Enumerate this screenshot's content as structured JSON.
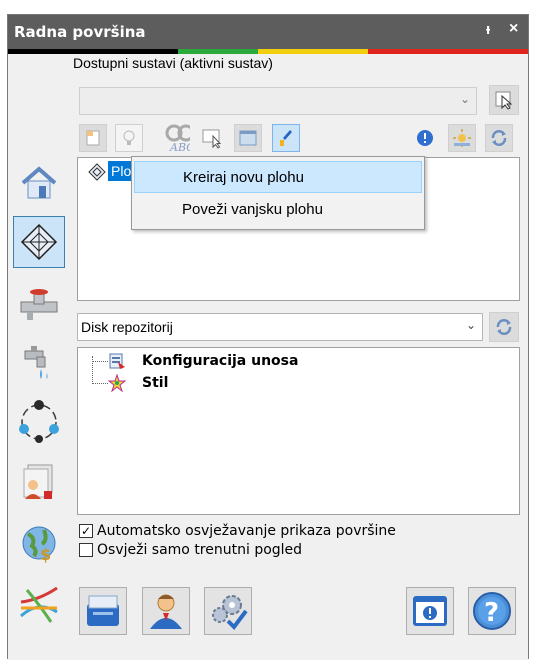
{
  "window": {
    "title": "Radna površina",
    "pin_glyph": "ᵻ",
    "close_glyph": "×"
  },
  "colors": {
    "title_bg": "#5d5d5d",
    "bar_green": "#2aaa3a",
    "bar_yellow": "#f2cf0d",
    "bar_red": "#e1231e",
    "selection": "#0078d7",
    "menu_hover": "#cce8ff"
  },
  "systems": {
    "label": "Dostupni sustavi (aktivni sustav)",
    "combo_value": "",
    "toolbar": [
      {
        "name": "new-document-icon"
      },
      {
        "name": "lightbulb-icon"
      },
      {
        "name": "abc-spellcheck-icon"
      },
      {
        "name": "select-cursor-icon"
      },
      {
        "name": "window-icon"
      },
      {
        "name": "brush-icon"
      },
      {
        "name": "info-icon"
      },
      {
        "name": "sun-icon"
      },
      {
        "name": "refresh-icon"
      }
    ]
  },
  "surfaces": {
    "item_label": "Ploh",
    "context_menu": [
      {
        "label": "Kreiraj novu plohu"
      },
      {
        "label": "Poveži vanjsku plohu"
      }
    ]
  },
  "repository": {
    "combo_value": "Disk repozitorij",
    "items": [
      {
        "label": "Konfiguracija unosa",
        "icon": "config-icon"
      },
      {
        "label": "Stil",
        "icon": "style-icon"
      }
    ]
  },
  "sidebar": [
    "home-icon",
    "surface-diamond-icon",
    "pipe-valve-icon",
    "water-tap-icon",
    "network-circle-icon",
    "user-report-icon",
    "globe-icon",
    "route-map-icon"
  ],
  "options": {
    "auto_refresh": {
      "label": "Automatsko osvježavanje prikaza površine",
      "checked": true
    },
    "refresh_current": {
      "label": "Osvježi samo trenutni pogled",
      "checked": false
    }
  },
  "bottom_buttons": [
    "cabinet-icon",
    "user-icon",
    "settings-check-icon",
    "info-window-icon",
    "help-icon"
  ]
}
